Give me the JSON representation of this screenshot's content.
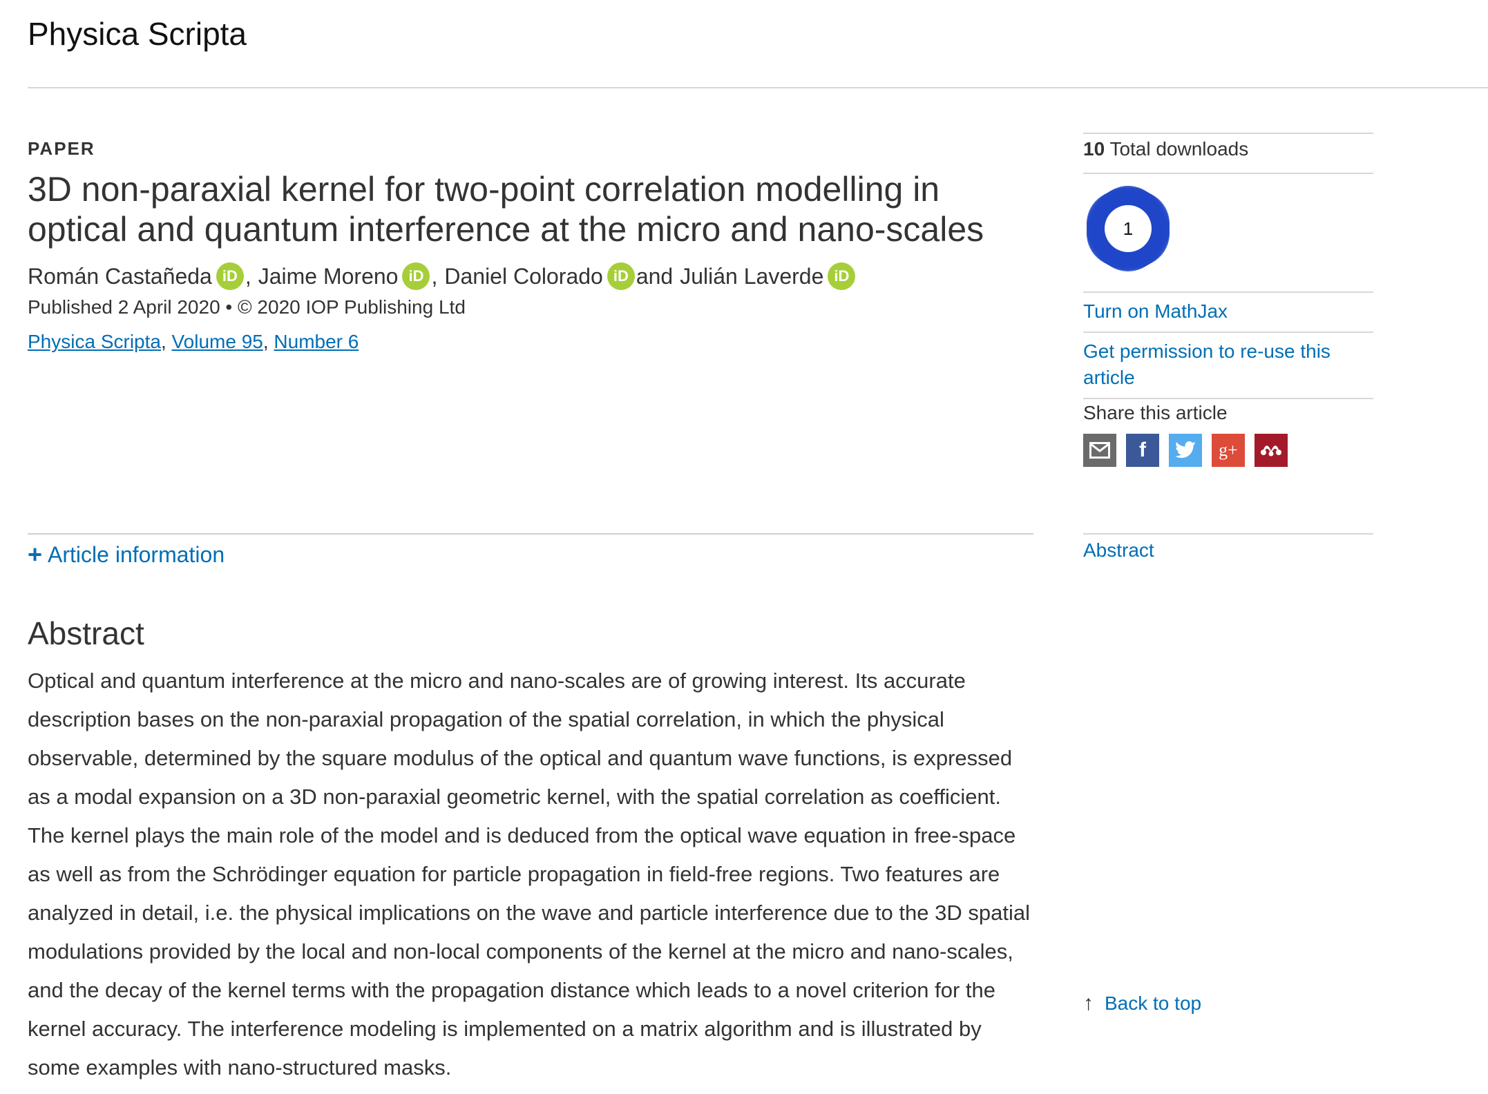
{
  "header": {
    "journal_title": "Physica Scripta"
  },
  "article": {
    "type_label": "PAPER",
    "title": "3D non-paraxial kernel for two-point correlation modelling in optical and quantum interference at the micro and nano-scales",
    "authors": [
      {
        "name": "Román Castañeda",
        "separator": ","
      },
      {
        "name": "Jaime Moreno",
        "separator": ","
      },
      {
        "name": "Daniel Colorado",
        "separator": " and"
      },
      {
        "name": "Julián Laverde",
        "separator": ""
      }
    ],
    "orcid_label": "iD",
    "published": "Published 2 April 2020 • © 2020 IOP Publishing Ltd",
    "journal_link": "Physica Scripta",
    "volume_link": "Volume 95",
    "number_link": "Number 6",
    "link_separator": ","
  },
  "article_info": {
    "label": "Article information"
  },
  "abstract": {
    "heading": "Abstract",
    "text": "Optical and quantum interference at the micro and nano-scales are of growing interest. Its accurate description bases on the non-paraxial propagation of the spatial correlation, in which the physical observable, determined by the square modulus of the optical and quantum wave functions, is expressed as a modal expansion on a 3D non-paraxial geometric kernel, with the spatial correlation as coefficient. The kernel plays the main role of the model and is deduced from the optical wave equation in free-space as well as from the Schrödinger equation for particle propagation in field-free regions. Two features are analyzed in detail, i.e. the physical implications on the wave and particle interference due to the 3D spatial modulations provided by the local and non-local components of the kernel at the micro and nano-scales, and the decay of the kernel terms with the propagation distance which leads to a novel criterion for the kernel accuracy. The interference modeling is implemented on a matrix algorithm and is illustrated by some examples with nano-structured masks."
  },
  "sidebar": {
    "downloads_count": "10",
    "downloads_label": "Total downloads",
    "altmetric_score": "1",
    "mathjax_link": "Turn on MathJax",
    "permission_link": "Get permission to re-use this article",
    "share_label": "Share this article",
    "share_buttons": [
      {
        "name": "email",
        "color": "#6b6b6b"
      },
      {
        "name": "facebook",
        "color": "#3b5998",
        "glyph": "f"
      },
      {
        "name": "twitter",
        "color": "#55acee"
      },
      {
        "name": "google-plus",
        "color": "#dd4b39",
        "glyph": "g+"
      },
      {
        "name": "mendeley",
        "color": "#a31b2b"
      }
    ],
    "abstract_nav_link": "Abstract",
    "back_to_top": "Back to top"
  }
}
